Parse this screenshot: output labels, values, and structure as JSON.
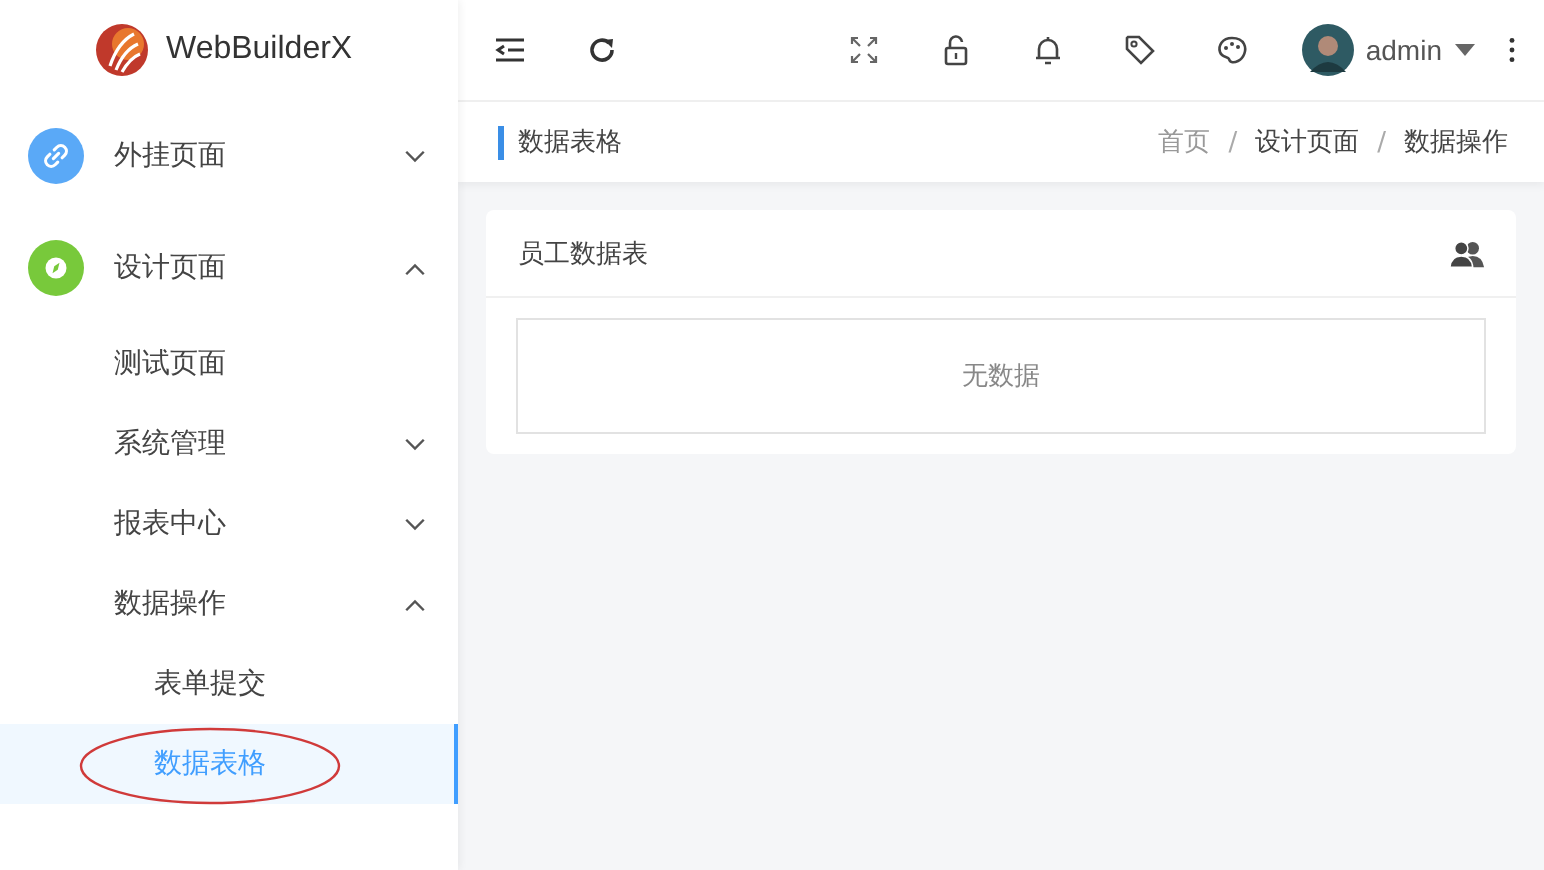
{
  "app": {
    "name": "WebBuilderX"
  },
  "sidebar": {
    "items": [
      {
        "label": "外挂页面",
        "kind": "group",
        "color": "#5aa9f7",
        "expanded": false,
        "selected": false
      },
      {
        "label": "设计页面",
        "kind": "group",
        "color": "#78c93b",
        "expanded": true,
        "selected": false,
        "children": [
          {
            "label": "测试页面",
            "kind": "leaf",
            "selected": false
          },
          {
            "label": "系统管理",
            "kind": "group",
            "expanded": false,
            "selected": false
          },
          {
            "label": "报表中心",
            "kind": "group",
            "expanded": false,
            "selected": false
          },
          {
            "label": "数据操作",
            "kind": "group",
            "expanded": true,
            "selected": false,
            "children": [
              {
                "label": "表单提交",
                "selected": false,
                "circled": false
              },
              {
                "label": "数据表格",
                "selected": true,
                "circled": true
              }
            ]
          }
        ]
      }
    ]
  },
  "user": {
    "name": "admin"
  },
  "page": {
    "title": "数据表格",
    "breadcrumb_separator": "/",
    "breadcrumb": [
      {
        "label": "首页",
        "current": false
      },
      {
        "label": "设计页面",
        "current": true
      },
      {
        "label": "数据操作",
        "current": true
      }
    ]
  },
  "card": {
    "title": "员工数据表",
    "empty_text": "无数据"
  }
}
